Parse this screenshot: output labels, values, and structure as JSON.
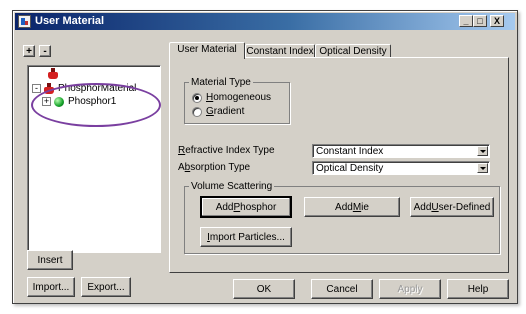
{
  "window": {
    "title": "User Material",
    "controls": {
      "minimize": "_",
      "maximize": "□",
      "close": "X"
    }
  },
  "tree_toolbar": {
    "expand_label": "+",
    "collapse_label": "-"
  },
  "tree": {
    "root_label": "",
    "items": [
      {
        "label": "PhosphorMaterial",
        "icon": "flask-icon",
        "expander": "-"
      },
      {
        "label": "Phosphor1",
        "icon": "phosphor-sphere-icon",
        "expander": "+"
      }
    ]
  },
  "left_buttons": {
    "insert": "Insert",
    "import": "Import...",
    "export": "Export..."
  },
  "tabs": [
    {
      "label": "User Material",
      "active": true
    },
    {
      "label": "Constant Index",
      "active": false
    },
    {
      "label": "Optical Density",
      "active": false
    }
  ],
  "material_type": {
    "group_label": "Material Type",
    "options": [
      {
        "mnemonic": "H",
        "rest": "omogeneous",
        "checked": true
      },
      {
        "mnemonic": "G",
        "rest": "radient",
        "checked": false
      }
    ]
  },
  "refractive_index": {
    "mnemonic": "R",
    "rest": "efractive Index Type",
    "value": "Constant Index"
  },
  "absorption": {
    "pre": "A",
    "mnemonic": "b",
    "rest": "sorption Type",
    "value": "Optical Density"
  },
  "volume_scattering": {
    "group_label": "Volume Scattering",
    "add_phosphor": {
      "pre": "Add ",
      "mnemonic": "P",
      "rest": "hosphor"
    },
    "add_mie": {
      "pre": "Add ",
      "mnemonic": "M",
      "rest": "ie"
    },
    "add_user_defined": {
      "pre": "Add ",
      "mnemonic": "U",
      "rest": "ser-Defined"
    },
    "import_particles": {
      "pre": "",
      "mnemonic": "I",
      "rest": "mport Particles..."
    }
  },
  "dialog_buttons": {
    "ok": "OK",
    "cancel": "Cancel",
    "apply": "Apply",
    "help": "Help"
  },
  "colors": {
    "highlight_ellipse": "#7a3fa0",
    "title_bar": "#0a246a",
    "dialog_face": "#d4d0c8"
  }
}
